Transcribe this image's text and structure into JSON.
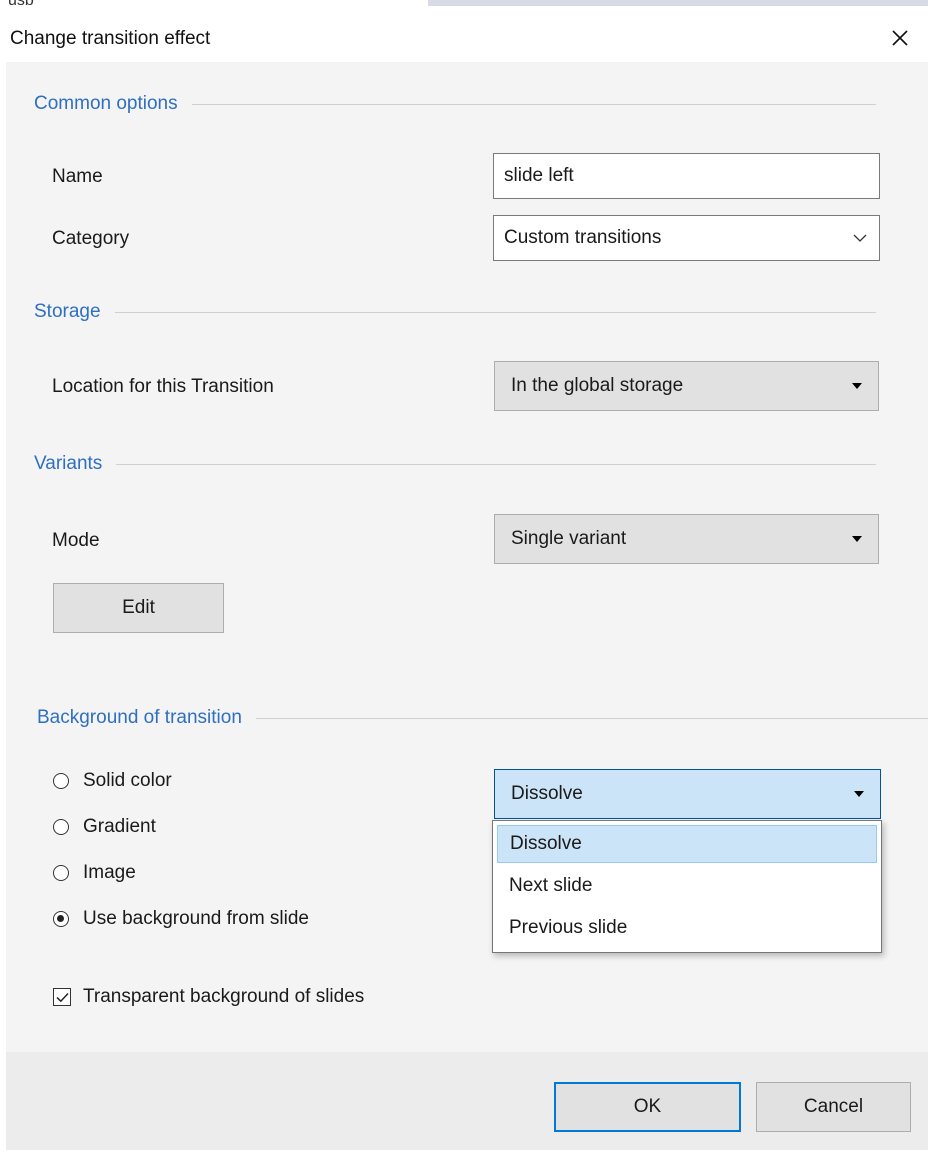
{
  "background_app": {
    "partial_text": "usb"
  },
  "dialog": {
    "title": "Change transition effect"
  },
  "common_options": {
    "heading": "Common options",
    "name_label": "Name",
    "name_value": "slide left",
    "category_label": "Category",
    "category_value": "Custom transitions"
  },
  "storage": {
    "heading": "Storage",
    "location_label": "Location for this Transition",
    "location_value": "In the global storage"
  },
  "variants": {
    "heading": "Variants",
    "mode_label": "Mode",
    "mode_value": "Single variant",
    "edit_label": "Edit"
  },
  "background": {
    "heading": "Background of transition",
    "radios": [
      {
        "label": "Solid color",
        "checked": false
      },
      {
        "label": "Gradient",
        "checked": false
      },
      {
        "label": "Image",
        "checked": false
      },
      {
        "label": "Use background from slide",
        "checked": true
      }
    ],
    "effect_value": "Dissolve",
    "effect_options": [
      "Dissolve",
      "Next slide",
      "Previous slide"
    ],
    "transparent_label": "Transparent background of slides",
    "transparent_checked": true
  },
  "footer": {
    "ok_label": "OK",
    "cancel_label": "Cancel"
  },
  "icons": [
    "close-icon",
    "chevron-down-icon",
    "dropdown-arrow-icon",
    "checkmark-icon"
  ]
}
